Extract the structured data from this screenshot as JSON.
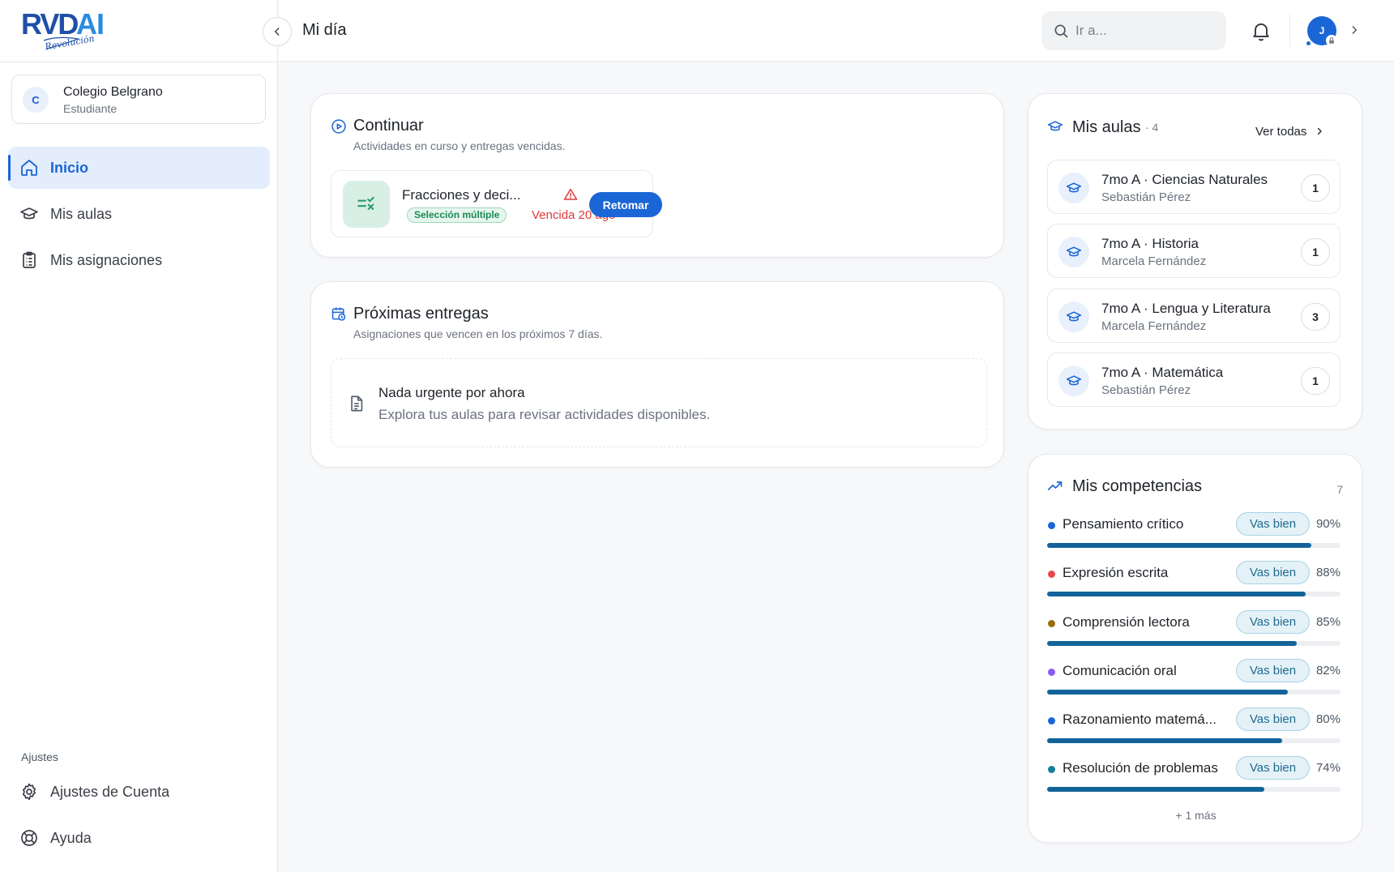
{
  "brand": {
    "logo_text": "RVDAI",
    "logo_script": "Revolución"
  },
  "org": {
    "initial": "C",
    "name": "Colegio Belgrano",
    "role": "Estudiante"
  },
  "nav": [
    {
      "label": "Inicio",
      "active": true,
      "icon": "home-icon"
    },
    {
      "label": "Mis aulas",
      "active": false,
      "icon": "graduation-cap-icon"
    },
    {
      "label": "Mis asignaciones",
      "active": false,
      "icon": "clipboard-icon"
    }
  ],
  "settings": {
    "heading": "Ajustes",
    "items": [
      {
        "label": "Ajustes de Cuenta",
        "icon": "gear-icon"
      },
      {
        "label": "Ayuda",
        "icon": "lifebuoy-icon"
      }
    ]
  },
  "header": {
    "title": "Mi día",
    "search_placeholder": "Ir a...",
    "avatar_initial": "J"
  },
  "continuar": {
    "title": "Continuar",
    "subtitle": "Actividades en curso y entregas vencidas.",
    "activity": {
      "title": "Fracciones y deci...",
      "badge": "Selección múltiple",
      "due": "Vencida 20 ago",
      "button": "Retomar"
    }
  },
  "proximas": {
    "title": "Próximas entregas",
    "subtitle": "Asignaciones que vencen en los próximos 7 días.",
    "empty_title": "Nada urgente por ahora",
    "empty_subtitle": "Explora tus aulas para revisar actividades disponibles."
  },
  "aulas": {
    "title": "Mis aulas",
    "count": "· 4",
    "see_all": "Ver todas",
    "items": [
      {
        "name": "7mo A · Ciencias Naturales",
        "teacher": "Sebastián Pérez",
        "count": "1"
      },
      {
        "name": "7mo A · Historia",
        "teacher": "Marcela Fernández",
        "count": "1"
      },
      {
        "name": "7mo A · Lengua y Literatura",
        "teacher": "Marcela Fernández",
        "count": "3"
      },
      {
        "name": "7mo A · Matemática",
        "teacher": "Sebastián Pérez",
        "count": "1"
      }
    ]
  },
  "competencias": {
    "title": "Mis competencias",
    "count": "7",
    "more": "+ 1 más",
    "items": [
      {
        "name": "Pensamiento crítico",
        "badge": "Vas bien",
        "pct": "90%",
        "value": 0.9,
        "dot": "#1a66d6"
      },
      {
        "name": "Expresión escrita",
        "badge": "Vas bien",
        "pct": "88%",
        "value": 0.88,
        "dot": "#e5484d"
      },
      {
        "name": "Comprensión lectora",
        "badge": "Vas bien",
        "pct": "85%",
        "value": 0.85,
        "dot": "#9a6b10"
      },
      {
        "name": "Comunicación oral",
        "badge": "Vas bien",
        "pct": "82%",
        "value": 0.82,
        "dot": "#8b5cf6"
      },
      {
        "name": "Razonamiento matemá...",
        "badge": "Vas bien",
        "pct": "80%",
        "value": 0.8,
        "dot": "#1a66d6"
      },
      {
        "name": "Resolución de problemas",
        "badge": "Vas bien",
        "pct": "74%",
        "value": 0.74,
        "dot": "#13809a"
      }
    ]
  }
}
